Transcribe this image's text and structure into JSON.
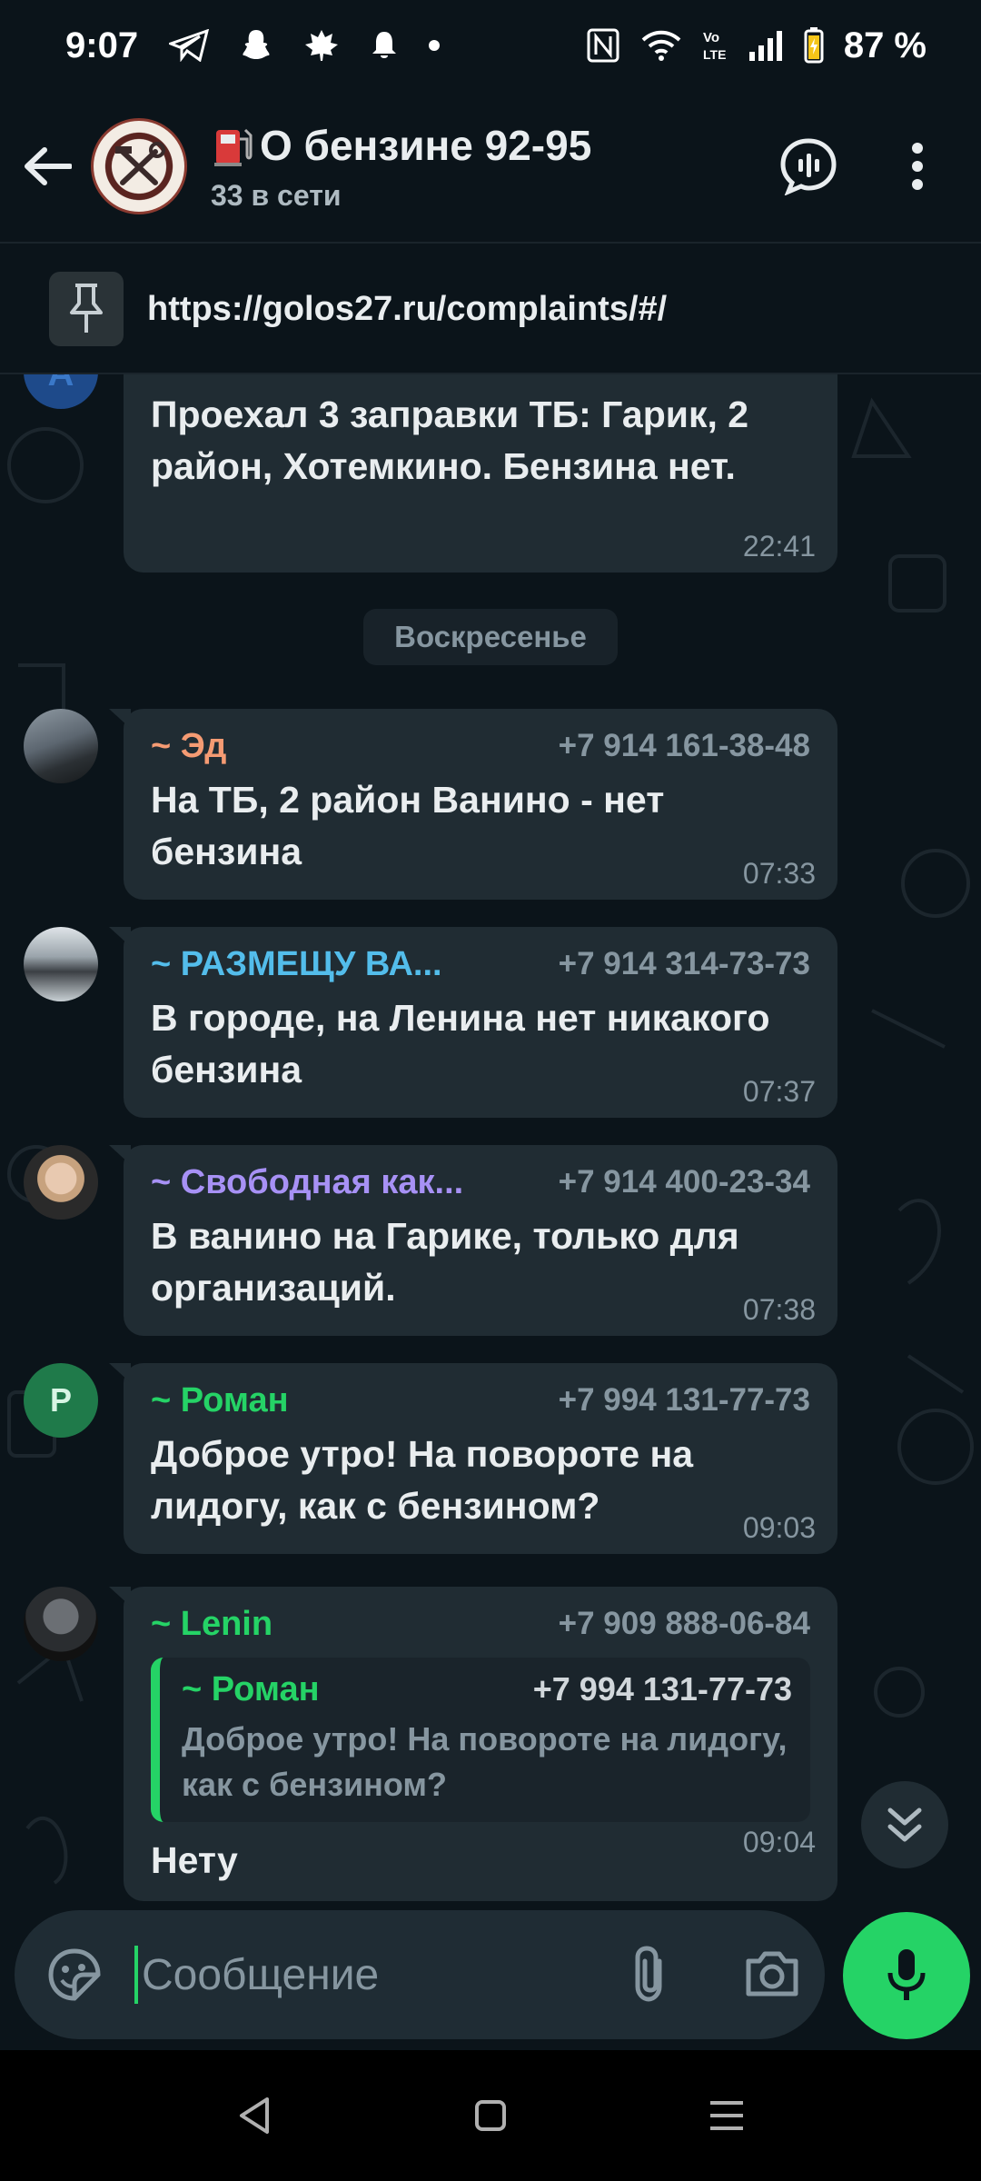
{
  "status_bar": {
    "time": "9:07",
    "battery": "87 %",
    "icons": [
      "telegram-icon",
      "snapchat-icon",
      "maple-leaf-icon",
      "bell-icon",
      "dot-icon",
      "nfc-icon",
      "wifi-icon",
      "volte-icon",
      "signal-icon",
      "battery-icon"
    ]
  },
  "header": {
    "title": "О бензине 92-95",
    "subtitle": "33 в сети",
    "title_emoji": "fuel-pump-icon",
    "actions": [
      "voice-chat-icon",
      "more-vert-icon"
    ]
  },
  "pinned": {
    "text": "https://golos27.ru/complaints/#/"
  },
  "top_partial_message": {
    "text": "Проехал 3 заправки ТБ: Гарик, 2 район, Хотемкино. Бензина нет.",
    "time": "22:41"
  },
  "date_separator": "Воскресенье",
  "messages": [
    {
      "sender": "~ Эд",
      "phone": "+7 914 161-38-48",
      "text": "На ТБ, 2 район Ванино - нет бензина",
      "time": "07:33",
      "color": "#f59b73"
    },
    {
      "sender": "~ РАЗМЕЩУ  ВА...",
      "phone": "+7 914 314-73-73",
      "text": "В городе, на Ленина нет никакого бензина",
      "time": "07:37",
      "color": "#53bdeb"
    },
    {
      "sender": "~ Свободная как...",
      "phone": "+7 914 400-23-34",
      "text": "В ванино на Гарике, только для организаций.",
      "time": "07:38",
      "color": "#a791f5"
    },
    {
      "sender": "~ Роман",
      "phone": "+7 994 131-77-73",
      "text": "Доброе утро! На повороте на лидогу, как с бензином?",
      "time": "09:03",
      "color": "#25d366",
      "avatar_letter": "Р"
    },
    {
      "sender": "~ Lenin",
      "phone": "+7 909 888-06-84",
      "quote": {
        "sender": "~ Роман",
        "phone": "+7 994 131-77-73",
        "text": "Доброе утро! На повороте на лидогу, как с бензином?"
      },
      "text": "Нету",
      "time": "09:04",
      "color": "#25d366"
    }
  ],
  "composer": {
    "placeholder": "Сообщение"
  },
  "colors": {
    "background": "#0b141a",
    "bubble": "#202c33",
    "accent": "#25d366",
    "muted": "#8696a0"
  }
}
